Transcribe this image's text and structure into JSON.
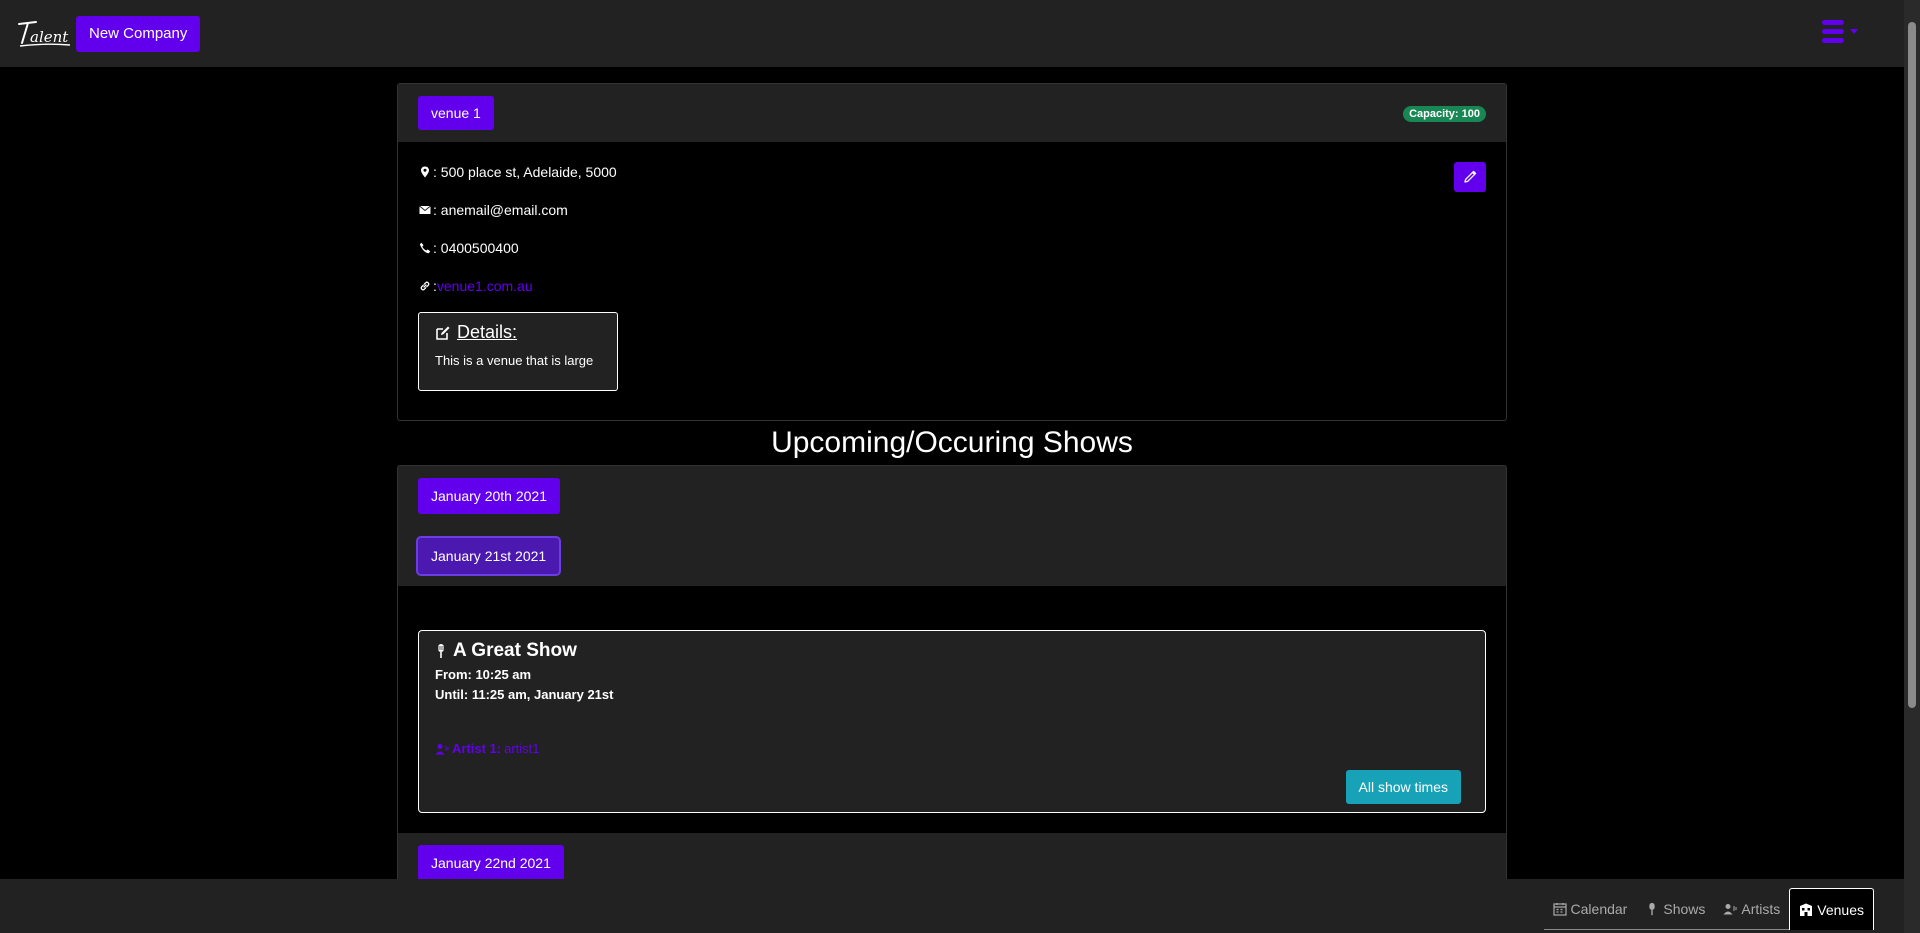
{
  "header": {
    "logo_text": "Talent",
    "new_company_label": "New Company",
    "menu_icon": "hamburger-menu-icon"
  },
  "venue": {
    "name": "venue 1",
    "capacity": "Capacity: 100",
    "address": ": 500 place st, Adelaide, 5000",
    "email": ": anemail@email.com",
    "phone": ": 0400500400",
    "website_prefix": ": ",
    "website": "venue1.com.au",
    "details_title": "Details:",
    "details_text": "This is a venue that is large"
  },
  "shows_section": {
    "title": "Upcoming/Occuring Shows",
    "dates": [
      {
        "label": "January 20th 2021"
      },
      {
        "label": "January 21st 2021"
      },
      {
        "label": "January 22nd 2021"
      }
    ],
    "show": {
      "title": "A Great Show",
      "from": "From: 10:25 am",
      "until": "Until: 11:25 am, January 21st",
      "artist_label": "Artist 1:",
      "artist_name": "artist1",
      "all_times_label": "All show times"
    }
  },
  "bottom_nav": {
    "tabs": [
      {
        "label": "Calendar"
      },
      {
        "label": "Shows"
      },
      {
        "label": "Artists"
      },
      {
        "label": "Venues"
      }
    ]
  },
  "colors": {
    "accent": "#6200ee",
    "success": "#198754",
    "info": "#17a2b8",
    "panel": "#222222"
  }
}
